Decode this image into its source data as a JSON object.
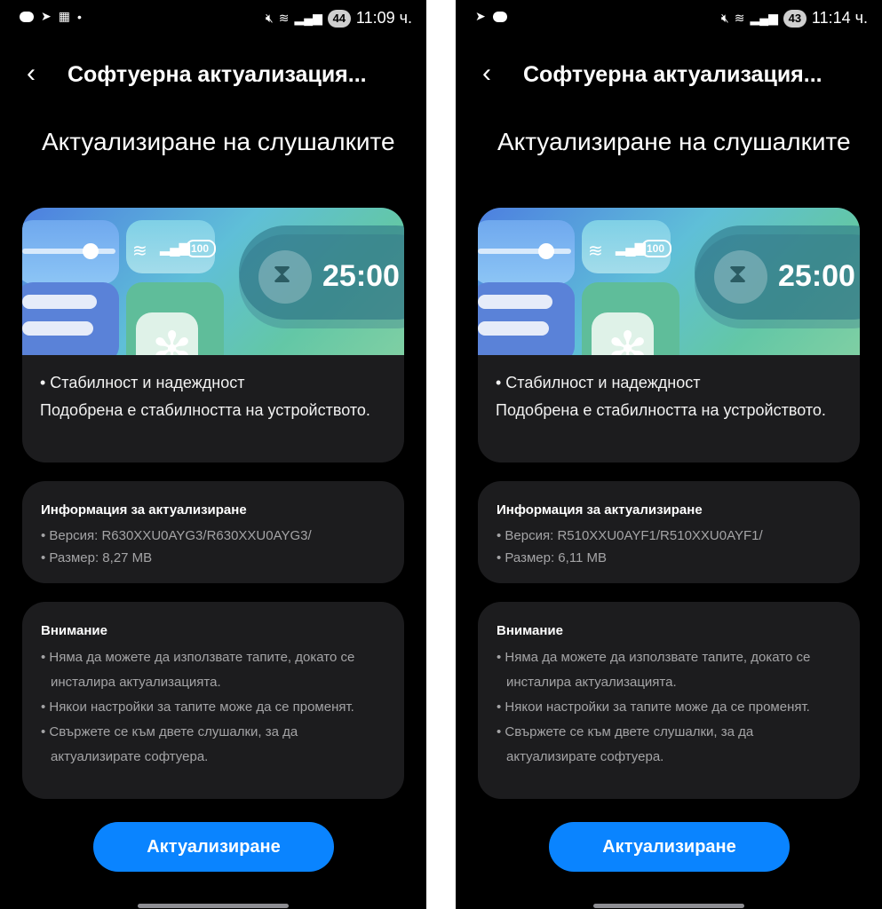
{
  "screens": [
    {
      "status": {
        "clock": "11:09 ч.",
        "battery": "44",
        "left_icons": [
          "chat-bubble-icon",
          "telegram-icon",
          "teams-icon",
          "dot-icon"
        ]
      },
      "header": {
        "title": "Софтуерна актуализация..."
      },
      "page_title": "Актуализиране на слушалките",
      "banner": {
        "timer": "25:00",
        "battery_label": "100"
      },
      "main": {
        "bullet": "• Стабилност и надеждност",
        "text": "Подобрена е стабилността на устройството."
      },
      "info": {
        "heading": "Информация за актуализиране",
        "version": "• Версия: R630XXU0AYG3/R630XXU0AYG3/",
        "size": "• Размер: 8,27 MB"
      },
      "warning": {
        "heading": "Внимание",
        "items": [
          "• Няма да можете да използвате тапите, докато се инсталира актуализацията.",
          "• Някои настройки за тапите може да се променят.",
          "• Свържете се към двете слушалки, за да актуализирате софтуера."
        ]
      },
      "button": "Актуализиране"
    },
    {
      "status": {
        "clock": "11:14 ч.",
        "battery": "43",
        "left_icons": [
          "telegram-icon",
          "chat-bubble-icon"
        ]
      },
      "header": {
        "title": "Софтуерна актуализация..."
      },
      "page_title": "Актуализиране на слушалките",
      "banner": {
        "timer": "25:00",
        "battery_label": "100"
      },
      "main": {
        "bullet": "• Стабилност и надеждност",
        "text": "Подобрена е стабилността на устройството."
      },
      "info": {
        "heading": "Информация за актуализиране",
        "version": "• Версия: R510XXU0AYF1/R510XXU0AYF1/",
        "size": "• Размер: 6,11 MB"
      },
      "warning": {
        "heading": "Внимание",
        "items": [
          "• Няма да можете да използвате тапите, докато се инсталира актуализацията.",
          "• Някои настройки за тапите може да се променят.",
          "• Свържете се към двете слушалки, за да актуализирате софтуера."
        ]
      },
      "button": "Актуализиране"
    }
  ],
  "colors": {
    "accent": "#0a84ff",
    "card": "#1c1c1e",
    "background": "#000000",
    "secondary_text": "#a4a4a6"
  }
}
